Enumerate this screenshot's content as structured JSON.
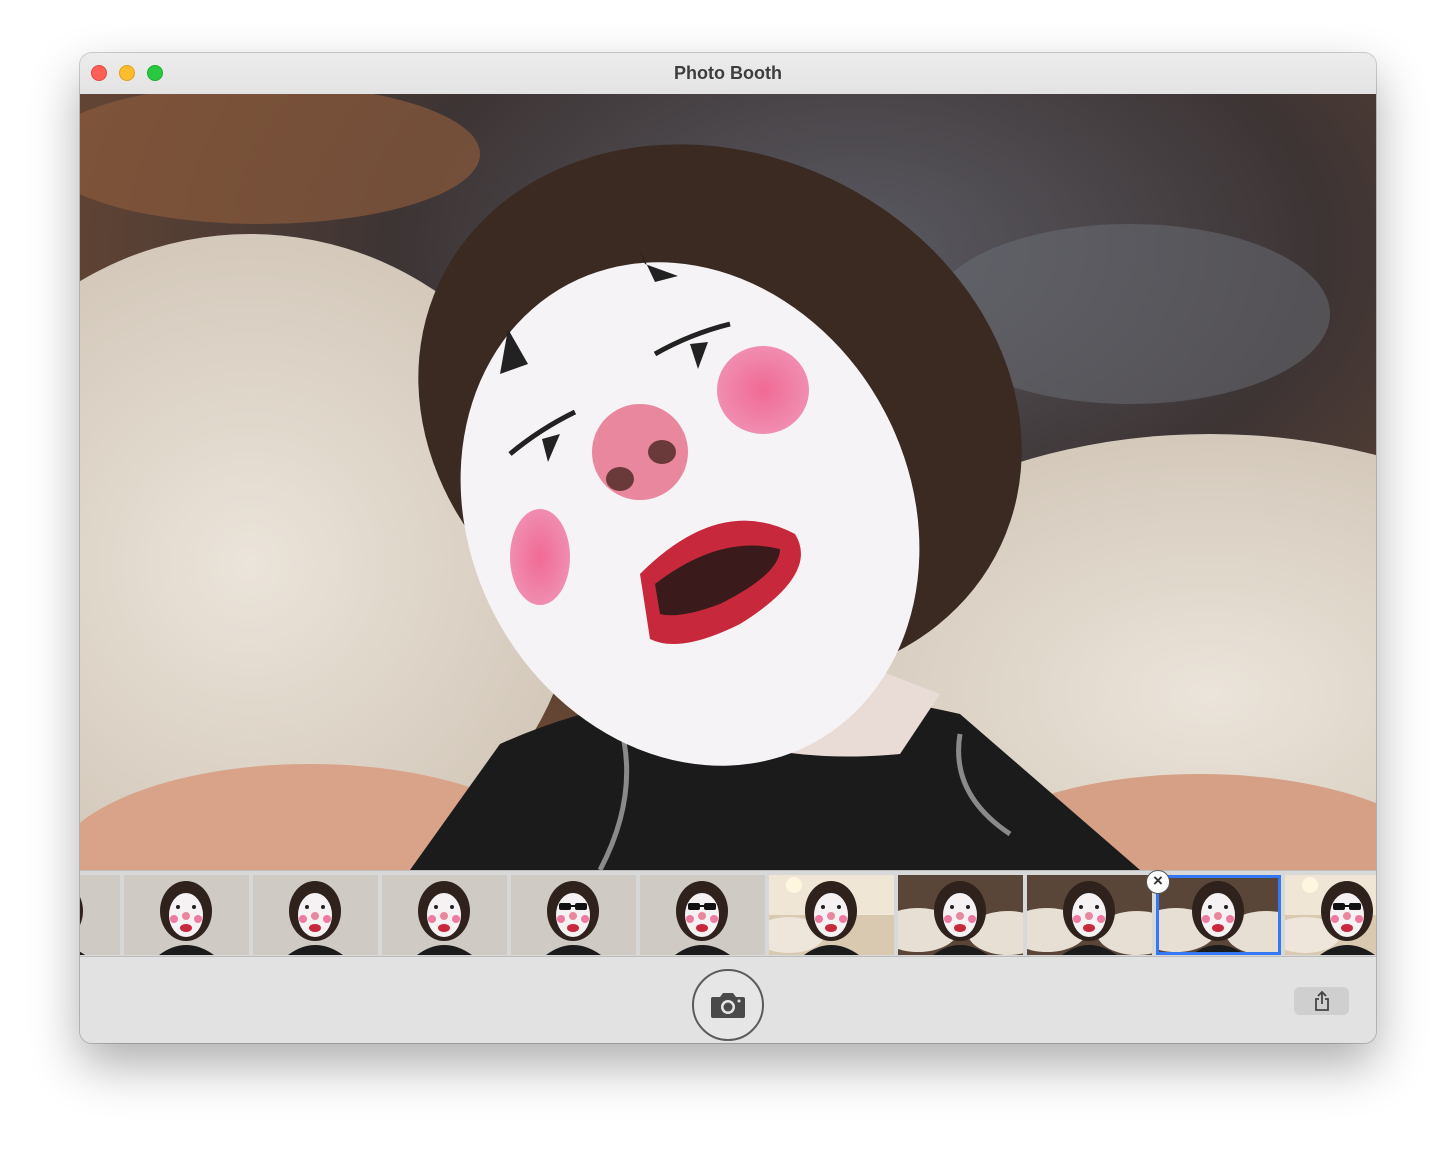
{
  "window": {
    "title": "Photo Booth"
  },
  "preview": {
    "description_icon": "clown-face-photo"
  },
  "filmstrip": {
    "thumbnails": [
      {
        "id": "thumb-1",
        "scene": "wall",
        "glasses": false
      },
      {
        "id": "thumb-2",
        "scene": "wall",
        "glasses": false
      },
      {
        "id": "thumb-3",
        "scene": "wall",
        "glasses": false
      },
      {
        "id": "thumb-4",
        "scene": "wall",
        "glasses": false
      },
      {
        "id": "thumb-5",
        "scene": "wall",
        "glasses": true
      },
      {
        "id": "thumb-6",
        "scene": "wall",
        "glasses": true
      },
      {
        "id": "thumb-7",
        "scene": "room",
        "glasses": false
      },
      {
        "id": "thumb-8",
        "scene": "fur",
        "glasses": false
      },
      {
        "id": "thumb-9",
        "scene": "fur",
        "glasses": false
      },
      {
        "id": "thumb-10",
        "scene": "fur",
        "glasses": false,
        "selected": true
      },
      {
        "id": "thumb-11",
        "scene": "room",
        "glasses": true
      }
    ],
    "delete_icon": "close-x-icon"
  },
  "toolbar": {
    "shutter_icon": "camera-icon",
    "share_icon": "share-icon"
  },
  "colors": {
    "selection": "#3478f6",
    "close": "#fe5f57",
    "minimize": "#febc2e",
    "maximize": "#28c840"
  }
}
